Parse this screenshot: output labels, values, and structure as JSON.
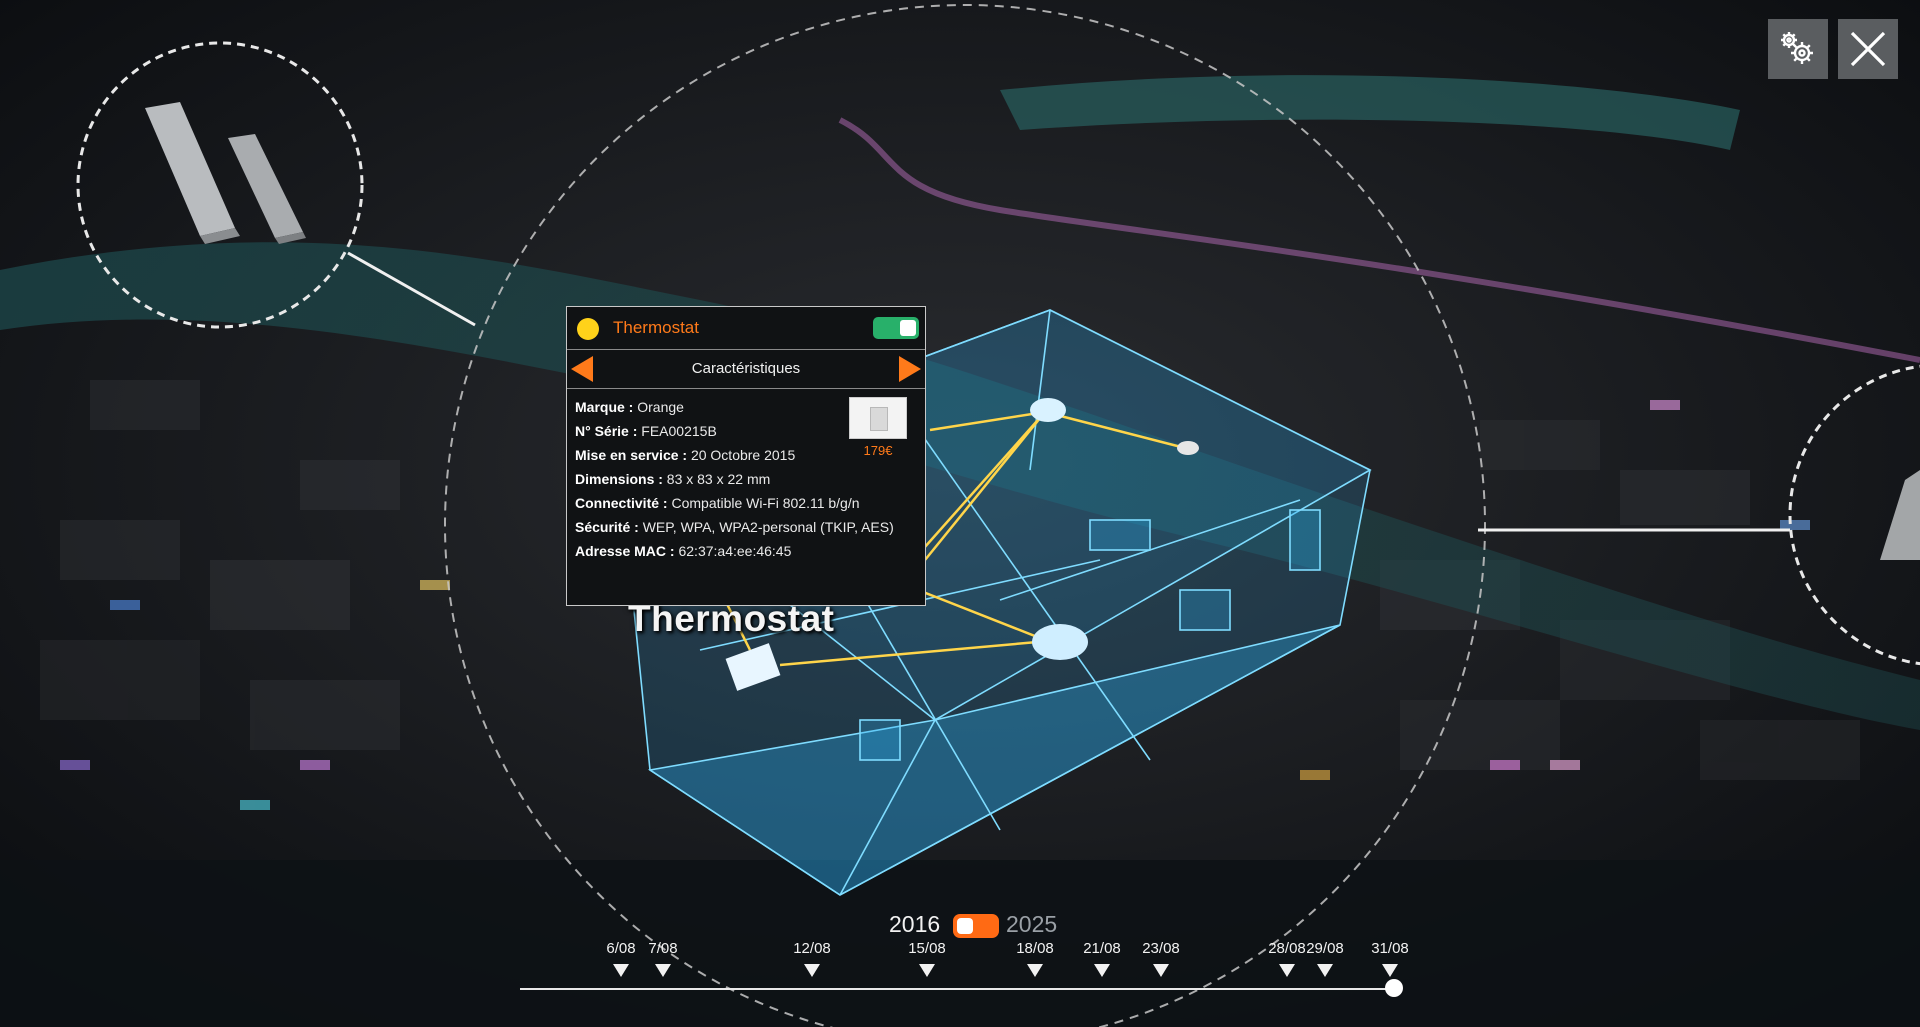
{
  "panel": {
    "title": "Thermostat",
    "section_label": "Caractéristiques",
    "status_color": "#ffd21a",
    "toggle_on": true,
    "specs": [
      {
        "label": "Marque :",
        "value": "Orange"
      },
      {
        "label": "N° Série :",
        "value": "FEA00215B"
      },
      {
        "label": "Mise en service :",
        "value": "20 Octobre 2015"
      },
      {
        "label": "Dimensions :",
        "value": "83 x 83 x 22 mm"
      },
      {
        "label": "Connectivité :",
        "value": "Compatible Wi-Fi 802.11 b/g/n"
      },
      {
        "label": "Sécurité :",
        "value": "WEP, WPA, WPA2-personal (TKIP, AES)"
      },
      {
        "label": "Adresse MAC :",
        "value": "62:37:a4:ee:46:45"
      }
    ],
    "price": "179€"
  },
  "scene_label": "Thermostat",
  "timeline": {
    "year_start": "2016",
    "year_end": "2025",
    "dates": [
      "6/08",
      "7/08",
      "12/08",
      "15/08",
      "18/08",
      "21/08",
      "23/08",
      "28/08",
      "29/08",
      "31/08"
    ]
  },
  "toolbar": {
    "settings_icon": "gears-icon",
    "close_icon": "close-icon"
  },
  "colors": {
    "accent": "#ff7a1a",
    "toggle_green": "#28b06a",
    "hologram": "#3ec4ff",
    "link_lines": "#ffd54a"
  }
}
